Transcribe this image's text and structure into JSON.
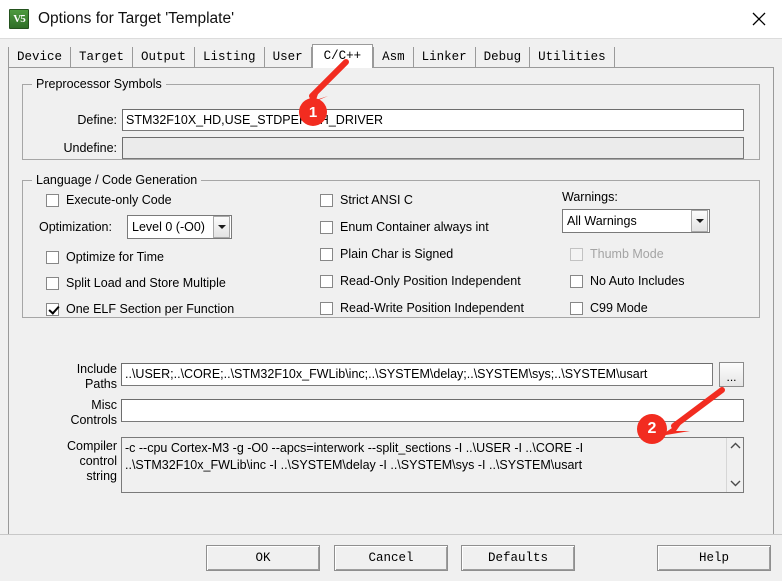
{
  "window": {
    "title": "Options for Target 'Template'",
    "icon": "uvision-logo-icon",
    "close_label": "close-icon"
  },
  "tabs": [
    {
      "label": "Device",
      "selected": false
    },
    {
      "label": "Target",
      "selected": false
    },
    {
      "label": "Output",
      "selected": false
    },
    {
      "label": "Listing",
      "selected": false
    },
    {
      "label": "User",
      "selected": false
    },
    {
      "label": "C/C++",
      "selected": true
    },
    {
      "label": "Asm",
      "selected": false
    },
    {
      "label": "Linker",
      "selected": false
    },
    {
      "label": "Debug",
      "selected": false
    },
    {
      "label": "Utilities",
      "selected": false
    }
  ],
  "preprocessor": {
    "legend": "Preprocessor Symbols",
    "define_label": "Define:",
    "define_value": "STM32F10X_HD,USE_STDPERIPH_DRIVER",
    "undefine_label": "Undefine:",
    "undefine_value": ""
  },
  "language": {
    "legend": "Language / Code Generation",
    "left_checks": [
      {
        "label": "Execute-only Code",
        "checked": false,
        "enabled": true
      },
      {
        "label": "Optimize for Time",
        "checked": false,
        "enabled": true
      },
      {
        "label": "Split Load and Store Multiple",
        "checked": false,
        "enabled": true
      },
      {
        "label": "One ELF Section per Function",
        "checked": true,
        "enabled": true
      }
    ],
    "optimization_label": "Optimization:",
    "optimization_value": "Level 0 (-O0)",
    "mid_checks": [
      {
        "label": "Strict ANSI C",
        "checked": false,
        "enabled": true
      },
      {
        "label": "Enum Container always int",
        "checked": false,
        "enabled": true
      },
      {
        "label": "Plain Char is Signed",
        "checked": false,
        "enabled": true
      },
      {
        "label": "Read-Only Position Independent",
        "checked": false,
        "enabled": true
      },
      {
        "label": "Read-Write Position Independent",
        "checked": false,
        "enabled": true
      }
    ],
    "warnings_label": "Warnings:",
    "warnings_value": "All Warnings",
    "right_checks": [
      {
        "label": "Thumb Mode",
        "checked": false,
        "enabled": false
      },
      {
        "label": "No Auto Includes",
        "checked": false,
        "enabled": true
      },
      {
        "label": "C99 Mode",
        "checked": false,
        "enabled": true
      }
    ]
  },
  "paths": {
    "include_label_line1": "Include",
    "include_label_line2": "Paths",
    "include_value": "..\\USER;..\\CORE;..\\STM32F10x_FWLib\\inc;..\\SYSTEM\\delay;..\\SYSTEM\\sys;..\\SYSTEM\\usart",
    "browse_label": "...",
    "misc_label_line1": "Misc",
    "misc_label_line2": "Controls",
    "misc_value": ""
  },
  "compiler": {
    "label_line1": "Compiler",
    "label_line2": "control",
    "label_line3": "string",
    "value": "-c --cpu Cortex-M3 -g -O0 --apcs=interwork --split_sections -I ..\\USER -I ..\\CORE -I ..\\STM32F10x_FWLib\\inc -I ..\\SYSTEM\\delay -I ..\\SYSTEM\\sys -I ..\\SYSTEM\\usart",
    "scroll_up": "⌃",
    "scroll_down": "⌄"
  },
  "buttons": {
    "ok": "OK",
    "cancel": "Cancel",
    "defaults": "Defaults",
    "help": "Help"
  },
  "annotations": {
    "accent_color": "#f22c20",
    "markers": [
      {
        "number": "1"
      },
      {
        "number": "2"
      }
    ]
  }
}
